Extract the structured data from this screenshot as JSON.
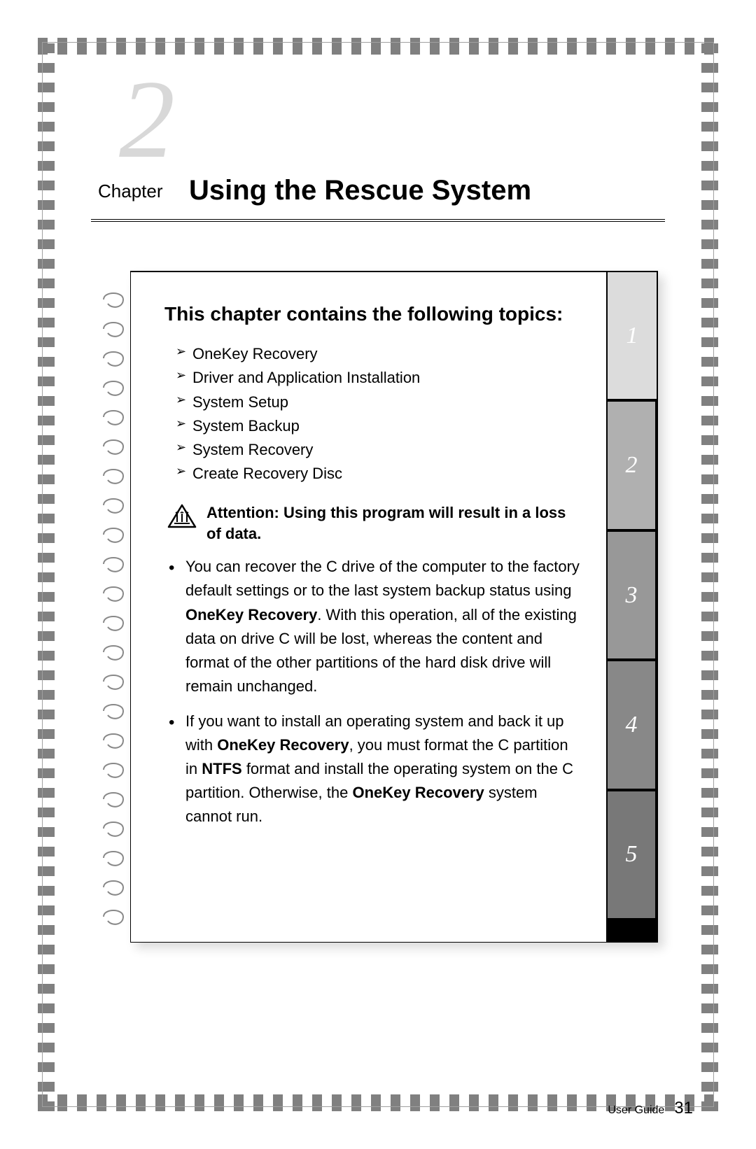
{
  "chapter": {
    "number": "2",
    "label": "Chapter",
    "title": "Using the Rescue System"
  },
  "topics": {
    "heading": "This chapter contains the following topics:",
    "items": [
      "OneKey Recovery",
      "Driver and Application Installation",
      "System Setup",
      "System Backup",
      "System Recovery",
      "Create Recovery Disc"
    ]
  },
  "attention": {
    "text": "Attention: Using this program will result in a loss of data."
  },
  "body": [
    {
      "pre": "You can recover the C drive of the computer to the factory default settings or to the last system backup status using ",
      "b1": "OneKey Recovery",
      "post": ". With this operation, all of the existing data on drive C will be lost, whereas the content and format of the other partitions of the hard disk drive will remain unchanged."
    },
    {
      "pre": "If you want to install an operating system and back it up with ",
      "b1": "OneKey Recovery",
      "mid1": ", you must format the C partition in ",
      "b2": "NTFS",
      "mid2": " format and install the operating system on the C partition. Otherwise, the ",
      "b3": "OneKey Recovery",
      "post": " system cannot run."
    }
  ],
  "tabs": [
    "1",
    "2",
    "3",
    "4",
    "5"
  ],
  "footer": {
    "label": "User Guide",
    "page": "31"
  }
}
